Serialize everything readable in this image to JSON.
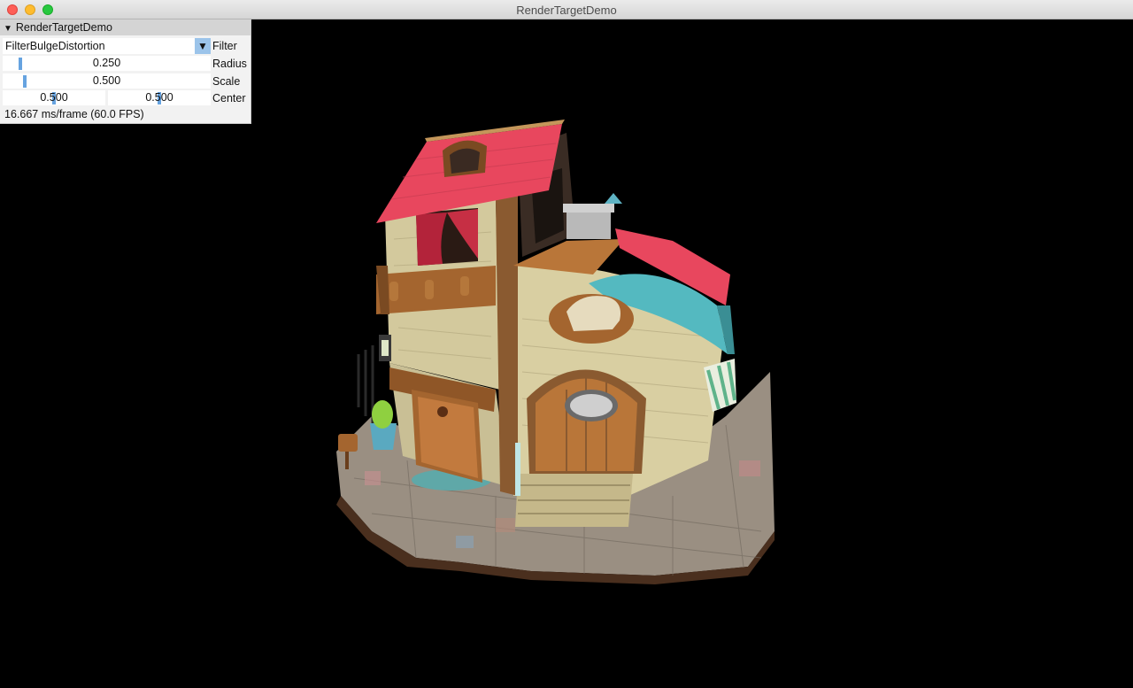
{
  "window": {
    "title": "RenderTargetDemo"
  },
  "panel": {
    "title": "RenderTargetDemo",
    "filter": {
      "value": "FilterBulgeDistortion",
      "label": "Filter"
    },
    "radius": {
      "value": "0.250",
      "label": "Radius",
      "level": 0.25
    },
    "scale": {
      "value": "0.500",
      "label": "Scale",
      "level": 0.5
    },
    "center": {
      "x": "0.500",
      "y": "0.500",
      "label": "Center"
    },
    "status": "16.667 ms/frame (60.0 FPS)"
  },
  "icons": {
    "collapse": "triangle-down-icon",
    "combo": "triangle-down-icon"
  },
  "colors": {
    "roof": "#e8475e",
    "awning": "#54b9c0",
    "wall": "#d6cca0",
    "wood": "#a4652f",
    "slider": "#66a3e0"
  }
}
